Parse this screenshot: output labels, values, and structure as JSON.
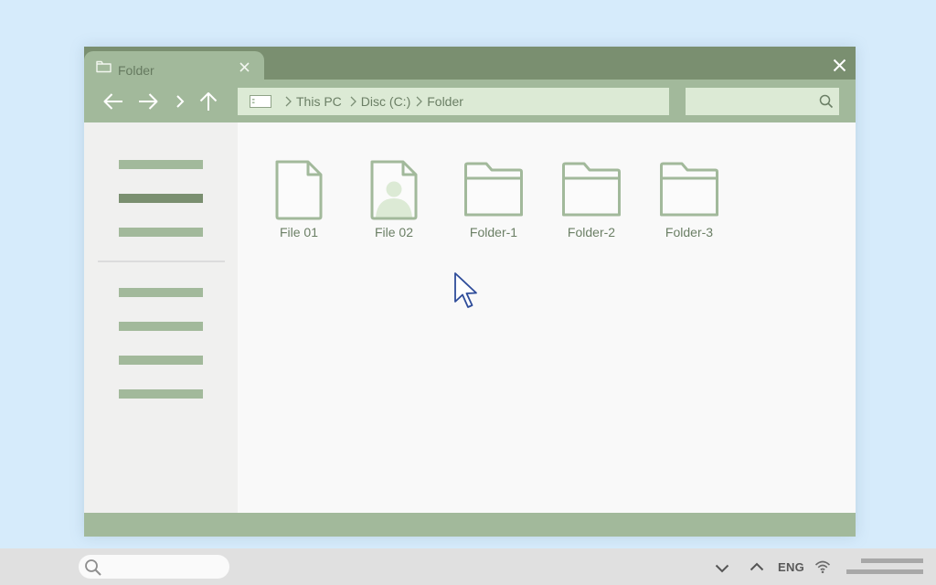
{
  "window": {
    "tab_title": "Folder",
    "icons": {
      "tab": "folder-icon",
      "tab_close": "close-icon",
      "window_close": "close-icon"
    }
  },
  "toolbar": {
    "nav": [
      "back-arrow-icon",
      "forward-arrow-icon",
      "recent-chevron-icon",
      "up-arrow-icon"
    ],
    "breadcrumb": [
      "This PC",
      "Disc (C:)",
      "Folder"
    ],
    "search": {
      "placeholder": "",
      "icon": "search-icon"
    }
  },
  "sidebar": {
    "group_1_count": 3,
    "group_2_count": 4,
    "active_index": 1
  },
  "items": [
    {
      "label": "File 01",
      "type": "file"
    },
    {
      "label": "File 02",
      "type": "image-file"
    },
    {
      "label": "Folder-1",
      "type": "folder"
    },
    {
      "label": "Folder-2",
      "type": "folder"
    },
    {
      "label": "Folder-3",
      "type": "folder"
    }
  ],
  "taskbar": {
    "search_placeholder": "",
    "language": "ENG",
    "tray_icons": [
      "chevron-down-icon",
      "chevron-up-icon",
      "wifi-icon"
    ]
  },
  "colors": {
    "accent_dark": "#7a8f70",
    "accent": "#a2b99b",
    "accent_light": "#dcead5",
    "desktop": "#d6ebfb",
    "cursor": "#2f4d9a"
  }
}
